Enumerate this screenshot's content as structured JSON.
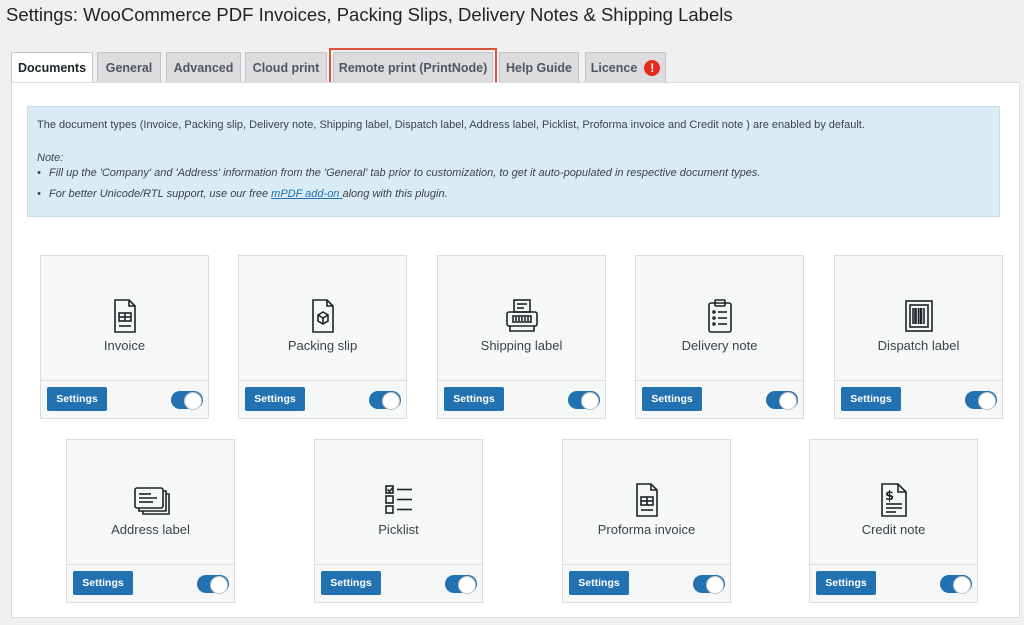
{
  "page_title": "Settings: WooCommerce PDF Invoices, Packing Slips, Delivery Notes & Shipping Labels",
  "tabs": [
    {
      "label": "Documents"
    },
    {
      "label": "General"
    },
    {
      "label": "Advanced"
    },
    {
      "label": "Cloud print"
    },
    {
      "label": "Remote print (PrintNode)"
    },
    {
      "label": "Help Guide"
    },
    {
      "label": "Licence"
    }
  ],
  "licence_alert": "!",
  "notice": {
    "line1": "The document types (Invoice, Packing slip, Delivery note, Shipping label, Dispatch label, Address label, Picklist, Proforma invoice and Credit note ) are enabled by default.",
    "note_label": "Note:",
    "bullet1": "Fill up the 'Company' and 'Address' information from the 'General' tab prior to customization, to get it auto-populated in respective document types.",
    "bullet2_prefix": "For better Unicode/RTL support, use our free ",
    "bullet2_link": "mPDF add-on ",
    "bullet2_suffix": "along with this plugin."
  },
  "settings_label": "Settings",
  "documents": [
    {
      "label": "Invoice",
      "icon": "invoice-icon",
      "enabled": true
    },
    {
      "label": "Packing slip",
      "icon": "packing-slip-icon",
      "enabled": true
    },
    {
      "label": "Shipping label",
      "icon": "shipping-label-icon",
      "enabled": true
    },
    {
      "label": "Delivery note",
      "icon": "delivery-note-icon",
      "enabled": true
    },
    {
      "label": "Dispatch label",
      "icon": "dispatch-label-icon",
      "enabled": true
    },
    {
      "label": "Address label",
      "icon": "address-label-icon",
      "enabled": true
    },
    {
      "label": "Picklist",
      "icon": "picklist-icon",
      "enabled": true
    },
    {
      "label": "Proforma invoice",
      "icon": "proforma-invoice-icon",
      "enabled": true
    },
    {
      "label": "Credit note",
      "icon": "credit-note-icon",
      "enabled": true
    }
  ],
  "colors": {
    "primary": "#2271b1",
    "highlight": "#e0533f",
    "alert": "#e52b20",
    "notice_bg": "#d9ecf5"
  }
}
